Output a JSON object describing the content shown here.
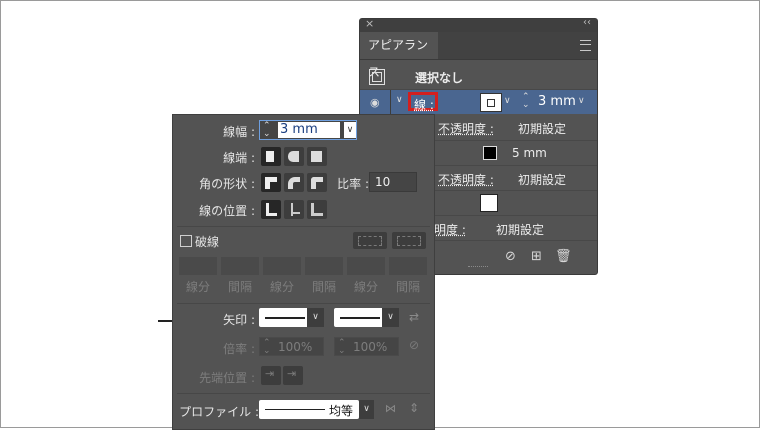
{
  "appearance": {
    "title": "アピアランス",
    "header_label": "選択なし",
    "stroke_row": {
      "label": "線 :",
      "weight": "3 mm"
    },
    "rows": [
      {
        "label": "不透明度 :",
        "value": "初期設定"
      },
      {
        "value": "5 mm"
      },
      {
        "label": "不透明度 :",
        "value": "初期設定"
      },
      {
        "label": ") :"
      },
      {
        "label": "透明度 :",
        "value": "初期設定"
      }
    ],
    "colors": {
      "highlight": "#d21f1f",
      "panel": "#535353"
    }
  },
  "stroke_panel": {
    "weight_label": "線幅 :",
    "weight_value": "3 mm",
    "cap_label": "線端 :",
    "corner_label": "角の形状 :",
    "limit_label": "比率 :",
    "limit_value": "10",
    "align_label": "線の位置 :",
    "dashed_label": "破線",
    "dash_labels": [
      "線分",
      "間隔",
      "線分",
      "間隔",
      "線分",
      "間隔"
    ],
    "arrow_label": "矢印 :",
    "scale_label": "倍率 :",
    "scale_start": "100%",
    "scale_end": "100%",
    "align_arrow_label": "先端位置 :",
    "profile_label": "プロファイル :",
    "profile_value": "均等"
  }
}
